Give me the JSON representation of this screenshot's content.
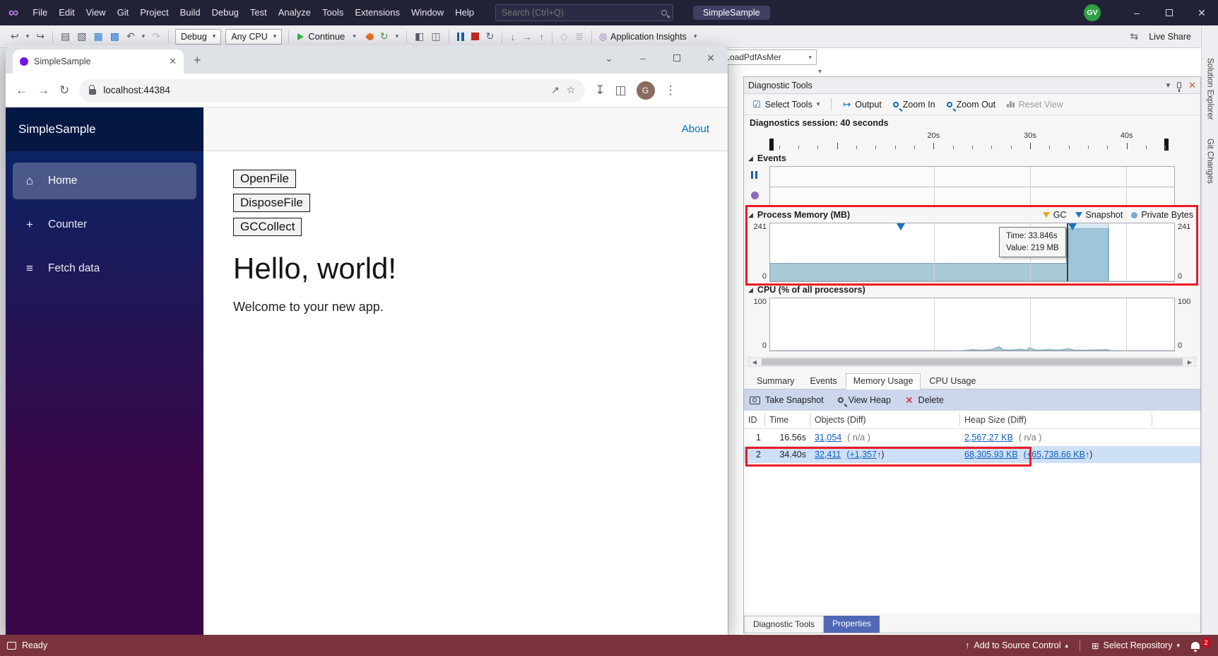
{
  "colors": {
    "annotation_red": "#EC1C24",
    "selection_blue": "#CDE0F7",
    "link_blue": "#0E5FBE",
    "chart_fill": "#A6C7D4",
    "status_bar": "#7A333C",
    "continue_green": "#2DB83D",
    "sidebar_gradient_top": "#052767",
    "sidebar_gradient_bottom": "#3A0647"
  },
  "vs": {
    "window_title": "SimpleSample",
    "menus": [
      "File",
      "Edit",
      "View",
      "Git",
      "Project",
      "Build",
      "Debug",
      "Test",
      "Analyze",
      "Tools",
      "Extensions",
      "Window",
      "Help"
    ],
    "search_placeholder": "Search (Ctrl+Q)",
    "titlebar_avatar": "GV",
    "toolbar": {
      "debug_config": "Debug",
      "platform": "Any CPU",
      "continue_label": "Continue",
      "app_insights_label": "Application Insights",
      "live_share_label": "Live Share",
      "icons": [
        {
          "name": "nav-back",
          "glyph": "↩"
        },
        {
          "name": "nav-forward",
          "glyph": "↪"
        },
        {
          "name": "new-file",
          "glyph": "▤"
        },
        {
          "name": "open-file",
          "glyph": "▧"
        },
        {
          "name": "save",
          "glyph": "▦"
        },
        {
          "name": "save-all",
          "glyph": "▩"
        },
        {
          "name": "undo",
          "glyph": "↶"
        },
        {
          "name": "redo",
          "glyph": "↷"
        },
        {
          "name": "restart",
          "glyph": "↻"
        },
        {
          "name": "code-window",
          "glyph": "◧"
        },
        {
          "name": "layout-window",
          "glyph": "◫"
        },
        {
          "name": "restart-app",
          "glyph": "↻"
        },
        {
          "name": "step-into",
          "glyph": "↓"
        },
        {
          "name": "step-over",
          "glyph": "→"
        },
        {
          "name": "step-out",
          "glyph": "↑"
        },
        {
          "name": "hex-display",
          "glyph": "◇"
        },
        {
          "name": "list-view",
          "glyph": "≣"
        },
        {
          "name": "app-insights",
          "glyph": "◎"
        },
        {
          "name": "live-share",
          "glyph": "⇆"
        },
        {
          "name": "caret",
          "glyph": "▾"
        }
      ]
    },
    "editor": {
      "nav_dropdown": "ndex.LoadPdfAsMer"
    },
    "right_tabs": [
      "Solution Explorer",
      "Git Changes"
    ],
    "status": {
      "ready": "Ready",
      "add_source_control": "Add to Source Control",
      "select_repository": "Select Repository",
      "notification_count": "2"
    }
  },
  "browser": {
    "tab_title": "SimpleSample",
    "url": "localhost:44384",
    "avatar": "G",
    "app": {
      "brand": "SimpleSample",
      "about_link": "About",
      "nav": [
        {
          "label": "Home",
          "icon": "home-icon"
        },
        {
          "label": "Counter",
          "icon": "plus-icon"
        },
        {
          "label": "Fetch data",
          "icon": "list-icon"
        }
      ],
      "buttons": [
        "OpenFile",
        "DisposeFile",
        "GCCollect"
      ],
      "heading": "Hello, world!",
      "subtitle": "Welcome to your new app."
    }
  },
  "diagnostics": {
    "panel_title": "Diagnostic Tools",
    "toolbar": {
      "select_tools": "Select Tools",
      "output": "Output",
      "zoom_in": "Zoom In",
      "zoom_out": "Zoom Out",
      "reset_view": "Reset View"
    },
    "session_label": "Diagnostics session: 40 seconds",
    "ruler_labels": [
      "20s",
      "30s",
      "40s"
    ],
    "sections": {
      "events": "Events",
      "memory": "Process Memory (MB)",
      "cpu": "CPU (% of all processors)"
    },
    "legend": [
      {
        "label": "GC"
      },
      {
        "label": "Snapshot"
      },
      {
        "label": "Private Bytes"
      }
    ],
    "memory_axis": {
      "max": "241",
      "min": "0"
    },
    "cpu_axis": {
      "max": "100",
      "min": "0"
    },
    "tooltip": {
      "line1": "Time: 33.846s",
      "line2": "Value: 219 MB"
    },
    "tabs": [
      "Summary",
      "Events",
      "Memory Usage",
      "CPU Usage"
    ],
    "actions": {
      "take_snapshot": "Take Snapshot",
      "view_heap": "View Heap",
      "delete": "Delete"
    },
    "table": {
      "headers": [
        "ID",
        "Time",
        "Objects (Diff)",
        "Heap Size (Diff)"
      ],
      "rows": [
        {
          "id": "1",
          "time": "16.56s",
          "objects": "31,054",
          "objects_diff": "( n/a )",
          "heap": "2,567.27 KB",
          "heap_diff": "( n/a )"
        },
        {
          "id": "2",
          "time": "34.40s",
          "objects": "32,411",
          "objects_diff_link": "(+1,357",
          "objects_diff_arrow": "↑",
          "objects_diff_close": ")",
          "heap": "68,305.93 KB",
          "heap_diff_link": "(+65,738.66 KB",
          "heap_diff_arrow": "↑",
          "heap_diff_close": ")"
        }
      ]
    },
    "bottom_tabs": [
      "Diagnostic Tools",
      "Properties"
    ]
  },
  "chart_data": [
    {
      "type": "area",
      "name": "process-memory",
      "title": "Process Memory (MB)",
      "x_range": [
        3,
        45
      ],
      "ylim": [
        0,
        241
      ],
      "points": [
        [
          3,
          75
        ],
        [
          33.8,
          75
        ],
        [
          33.8,
          219
        ],
        [
          38.2,
          219
        ],
        [
          38.2,
          0
        ]
      ],
      "gridlines": [
        20,
        30,
        40
      ],
      "snapshots": [
        16.56,
        34.4
      ],
      "cursor": 33.846,
      "selection": [
        33.846,
        38.2
      ],
      "y_labels": [
        "241",
        "0"
      ]
    },
    {
      "type": "area",
      "name": "cpu-usage",
      "title": "CPU (% of all processors)",
      "x_range": [
        3,
        45
      ],
      "ylim": [
        0,
        100
      ],
      "points": [
        [
          3,
          0
        ],
        [
          23,
          0
        ],
        [
          24,
          2
        ],
        [
          25,
          1
        ],
        [
          26,
          2
        ],
        [
          26.8,
          8
        ],
        [
          27.2,
          2
        ],
        [
          28,
          1
        ],
        [
          29,
          3
        ],
        [
          29.6,
          1
        ],
        [
          30,
          6
        ],
        [
          30.4,
          2
        ],
        [
          31,
          1
        ],
        [
          32,
          2
        ],
        [
          33,
          1
        ],
        [
          34,
          4
        ],
        [
          34.6,
          1
        ],
        [
          36,
          1
        ],
        [
          38,
          2
        ],
        [
          38.4,
          0
        ],
        [
          45,
          0
        ]
      ],
      "gridlines": [
        20,
        30,
        40
      ],
      "y_labels": [
        "100",
        "0"
      ]
    }
  ]
}
